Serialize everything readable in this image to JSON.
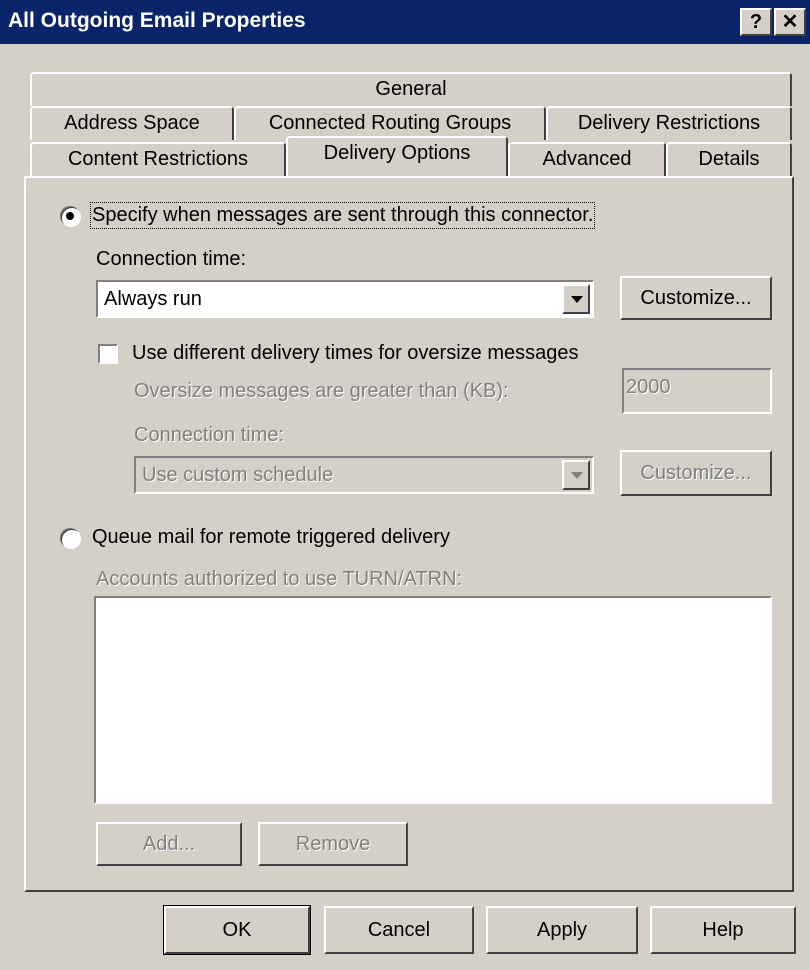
{
  "window": {
    "title": "All Outgoing Email Properties",
    "help_glyph": "?",
    "close_glyph": "✕"
  },
  "tabs": {
    "row1": [
      "General"
    ],
    "row2": [
      "Address Space",
      "Connected Routing Groups",
      "Delivery Restrictions"
    ],
    "row3": [
      "Content Restrictions",
      "Delivery Options",
      "Advanced",
      "Details"
    ],
    "selected": "Delivery Options"
  },
  "delivery": {
    "specify_radio": {
      "label": "Specify when messages are sent through this connector.",
      "checked": true
    },
    "connection_time_label": "Connection time:",
    "connection_time_value": "Always run",
    "customize_label": "Customize...",
    "oversize_checkbox": {
      "label": "Use different delivery times for oversize messages",
      "checked": false
    },
    "oversize_threshold_label": "Oversize messages are greater than (KB):",
    "oversize_threshold_value": "2000",
    "oversize_connection_time_label": "Connection time:",
    "oversize_connection_time_value": "Use custom schedule",
    "oversize_customize_label": "Customize..."
  },
  "queue": {
    "radio": {
      "label": "Queue mail for remote triggered delivery",
      "checked": false
    },
    "accounts_label": "Accounts authorized to use TURN/ATRN:",
    "add_label": "Add...",
    "remove_label": "Remove"
  },
  "footer": {
    "ok": "OK",
    "cancel": "Cancel",
    "apply": "Apply",
    "help": "Help"
  }
}
